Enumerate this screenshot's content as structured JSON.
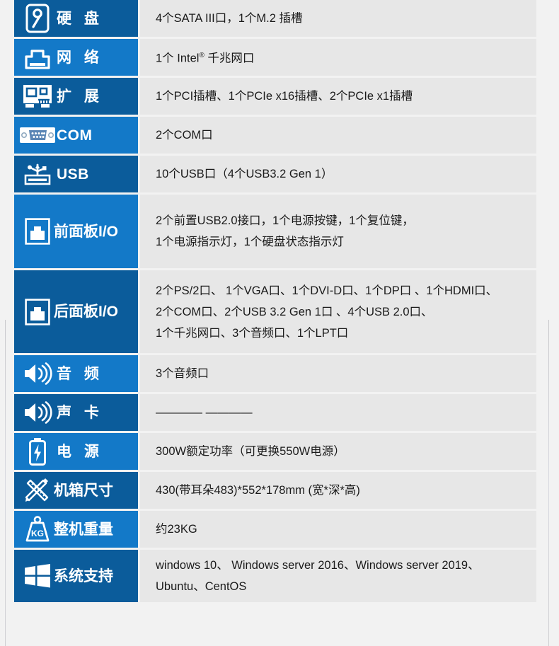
{
  "spec_table": {
    "rows": [
      {
        "icon": "hard-disk-icon",
        "label": "硬 盘",
        "label_style": "spaced-cjk",
        "shade": "dark",
        "height": "h-std",
        "lines": [
          "4个SATA III口，1个M.2 插槽"
        ]
      },
      {
        "icon": "network-port-icon",
        "label": "网 络",
        "label_style": "spaced-cjk",
        "shade": "light",
        "height": "h-std",
        "lines": [
          "1个 Intel® 千兆网口"
        ]
      },
      {
        "icon": "expansion-card-icon",
        "label": "扩 展",
        "label_style": "spaced-cjk",
        "shade": "dark",
        "height": "h-std",
        "lines": [
          "1个PCI插槽、1个PCIe x16插槽、2个PCIe x1插槽"
        ]
      },
      {
        "icon": "serial-port-icon",
        "label": "COM",
        "label_style": "latin",
        "shade": "light",
        "height": "h-std",
        "lines": [
          "2个COM口"
        ]
      },
      {
        "icon": "usb-icon",
        "label": "USB",
        "label_style": "latin",
        "shade": "dark",
        "height": "h-std",
        "lines": [
          "10个USB口（4个USB3.2 Gen 1）"
        ]
      },
      {
        "icon": "front-panel-io-icon",
        "label": "前面板I/O",
        "label_style": "tight",
        "shade": "light",
        "height": "h-tall2",
        "lines": [
          "2个前置USB2.0接口，1个电源按键，1个复位键，",
          "1个电源指示灯，1个硬盘状态指示灯"
        ]
      },
      {
        "icon": "rear-panel-io-icon",
        "label": "后面板I/O",
        "label_style": "tight",
        "shade": "dark",
        "height": "h-tall3",
        "lines": [
          "2个PS/2口、 1个VGA口、1个DVI-D口、1个DP口 、1个HDMI口、",
          "2个COM口、2个USB 3.2 Gen 1口 、4个USB 2.0口、",
          "1个千兆网口、3个音频口、1个LPT口"
        ]
      },
      {
        "icon": "audio-speaker-icon",
        "label": "音 频",
        "label_style": "spaced-cjk",
        "shade": "light",
        "height": "h-std",
        "lines": [
          "3个音频口"
        ]
      },
      {
        "icon": "audio-speaker-icon",
        "label": "声 卡",
        "label_style": "spaced-cjk",
        "shade": "dark",
        "height": "h-std",
        "lines": [
          "———— ————"
        ]
      },
      {
        "icon": "power-battery-icon",
        "label": "电 源",
        "label_style": "spaced-cjk",
        "shade": "light",
        "height": "h-std",
        "lines": [
          "300W额定功率（可更换550W电源）"
        ]
      },
      {
        "icon": "dimensions-ruler-icon",
        "label": "机箱尺寸",
        "label_style": "tight",
        "shade": "dark",
        "height": "h-std",
        "lines": [
          "430(带耳朵483)*552*178mm (宽*深*高)"
        ]
      },
      {
        "icon": "weight-kg-icon",
        "label": "整机重量",
        "label_style": "tight",
        "shade": "light",
        "height": "h-std",
        "lines": [
          "约23KG"
        ]
      },
      {
        "icon": "windows-logo-icon",
        "label": "系统支持",
        "label_style": "tight",
        "shade": "dark",
        "height": "h-os",
        "lines": [
          "windows 10、 Windows server 2016、Windows server 2019、",
          "Ubuntu、CentOS"
        ]
      }
    ],
    "colors": {
      "blue_dark": "#0b5c9b",
      "blue_light": "#1379c8",
      "value_bg": "#e7e7e7",
      "page_bg": "#f2f2f2",
      "text": "#1a1a1a"
    }
  }
}
